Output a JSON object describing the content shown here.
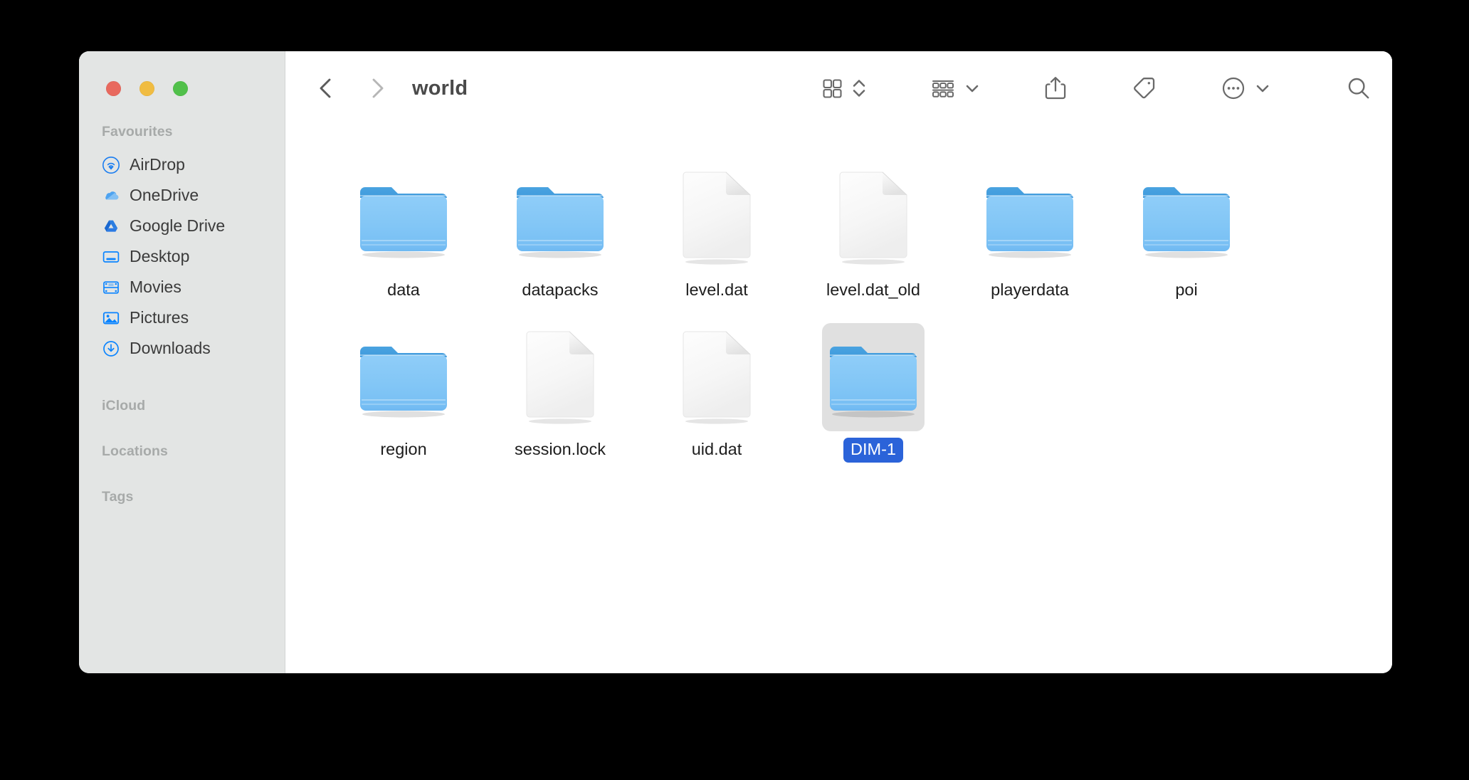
{
  "window": {
    "title": "world",
    "traffic_lights": [
      {
        "name": "close",
        "color": "#e8695e"
      },
      {
        "name": "minimize",
        "color": "#f0bc42"
      },
      {
        "name": "maximize",
        "color": "#51c04a"
      }
    ]
  },
  "toolbar": {
    "back_icon": "chevron-left-icon",
    "forward_icon": "chevron-right-icon",
    "view_icon": "icon-view-grid-icon",
    "view_stepper_icon": "chevron-up-down-icon",
    "group_icon": "group-by-icon",
    "group_chevron_icon": "chevron-down-icon",
    "share_icon": "share-icon",
    "tag_icon": "tag-icon",
    "more_icon": "ellipsis-circle-icon",
    "more_chevron_icon": "chevron-down-icon",
    "search_icon": "search-icon"
  },
  "sidebar": {
    "sections": [
      {
        "title": "Favourites",
        "items": [
          {
            "label": "AirDrop",
            "icon": "airdrop-icon"
          },
          {
            "label": "OneDrive",
            "icon": "onedrive-icon"
          },
          {
            "label": "Google Drive",
            "icon": "google-drive-icon"
          },
          {
            "label": "Desktop",
            "icon": "desktop-icon"
          },
          {
            "label": "Movies",
            "icon": "movies-icon"
          },
          {
            "label": "Pictures",
            "icon": "pictures-icon"
          },
          {
            "label": "Downloads",
            "icon": "downloads-icon"
          }
        ]
      },
      {
        "title": "iCloud",
        "items": []
      },
      {
        "title": "Locations",
        "items": []
      },
      {
        "title": "Tags",
        "items": []
      }
    ]
  },
  "files": {
    "selection_color": "#2b63d9",
    "items": [
      {
        "name": "data",
        "kind": "folder",
        "selected": false
      },
      {
        "name": "datapacks",
        "kind": "folder",
        "selected": false
      },
      {
        "name": "level.dat",
        "kind": "document",
        "selected": false
      },
      {
        "name": "level.dat_old",
        "kind": "document",
        "selected": false
      },
      {
        "name": "playerdata",
        "kind": "folder",
        "selected": false
      },
      {
        "name": "poi",
        "kind": "folder",
        "selected": false
      },
      {
        "name": "region",
        "kind": "folder",
        "selected": false
      },
      {
        "name": "session.lock",
        "kind": "document",
        "selected": false
      },
      {
        "name": "uid.dat",
        "kind": "document",
        "selected": false
      },
      {
        "name": "DIM-1",
        "kind": "folder",
        "selected": true
      }
    ]
  }
}
